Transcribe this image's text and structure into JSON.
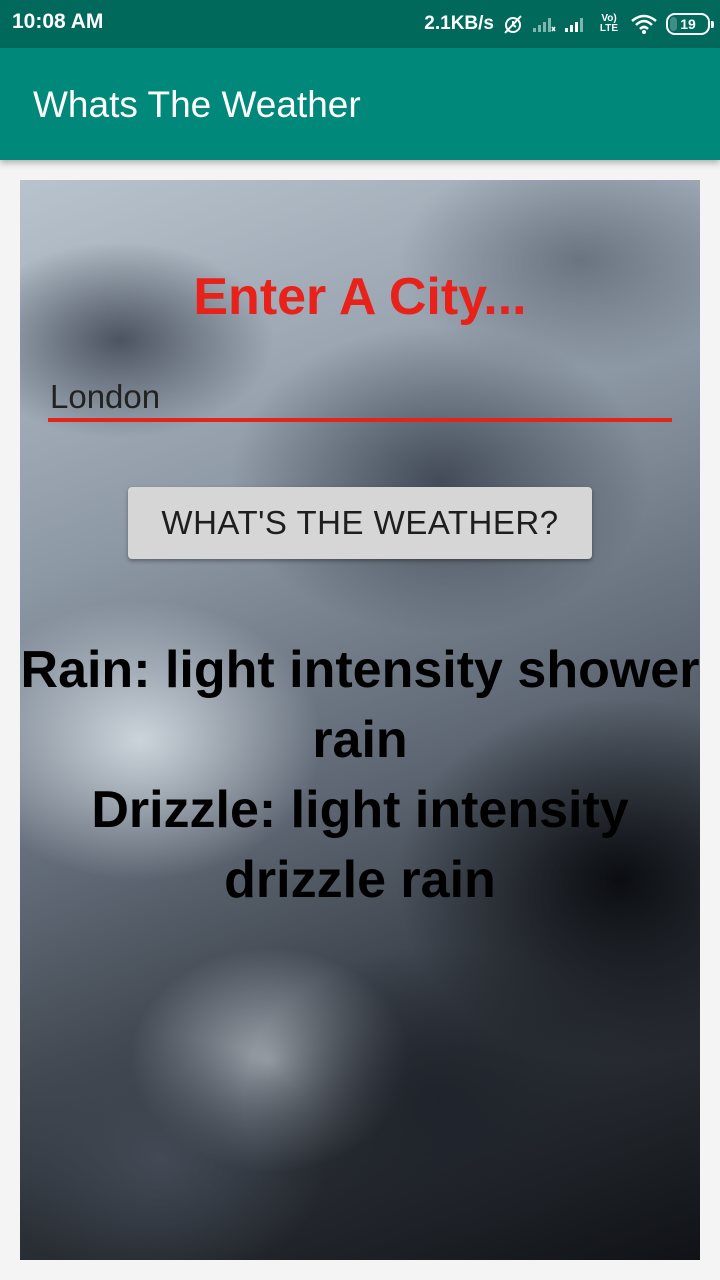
{
  "status_bar": {
    "time": "10:08 AM",
    "net_speed": "2.1KB/s",
    "network_type": "Vo) LTE",
    "battery_level": "19",
    "icons": [
      "alarm-off-icon",
      "signal-weak-icon",
      "signal-icon",
      "volte-icon",
      "wifi-icon",
      "battery-icon"
    ]
  },
  "app_bar": {
    "title": "Whats The Weather"
  },
  "main": {
    "heading": "Enter A City...",
    "city_input": {
      "value": "London"
    },
    "button_label": "WHAT'S THE WEATHER?",
    "result_text": "Rain: light intensity shower rain\nDrizzle: light intensity drizzle rain"
  },
  "colors": {
    "status_bar": "#00695c",
    "app_bar": "#00897b",
    "heading": "#e8221a",
    "input_underline": "#e0261c",
    "button": "#d6d6d6"
  }
}
